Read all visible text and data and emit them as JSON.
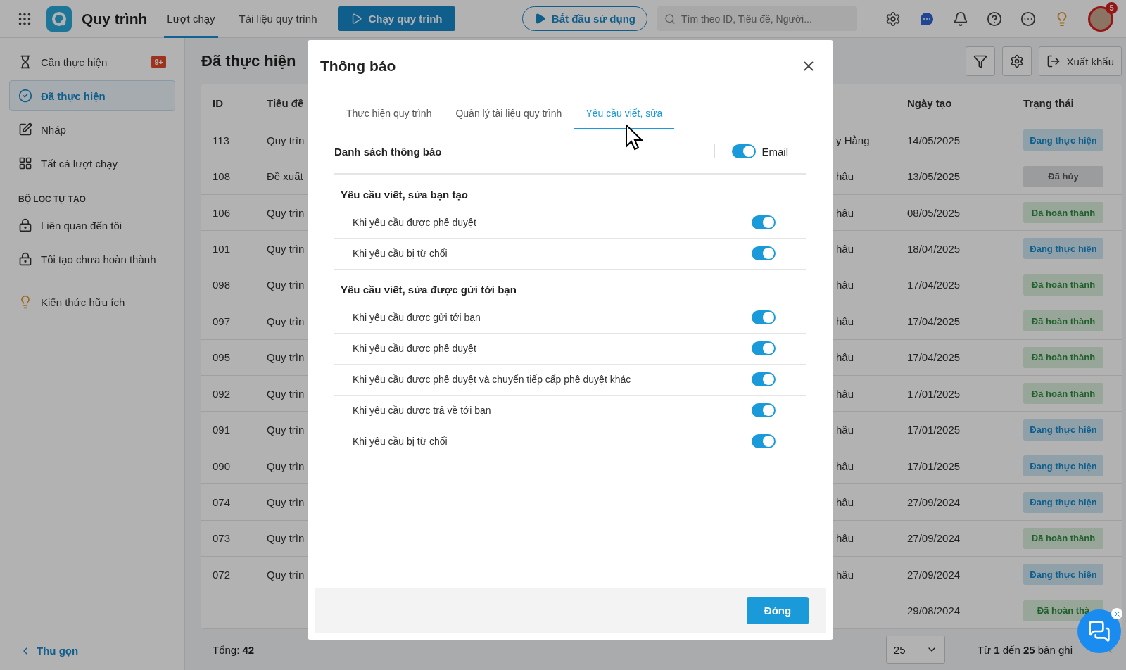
{
  "app": {
    "name": "Quy trình",
    "nav": [
      {
        "label": "Lượt chạy",
        "selected": true
      },
      {
        "label": "Tài liệu quy trình",
        "selected": false
      }
    ],
    "run_button": "Chạy quy trình",
    "start_button": "Bắt đầu sử dụng",
    "search": {
      "placeholder": "Tìm theo ID, Tiêu đề, Người..."
    },
    "notification_count": "5"
  },
  "sidebar": {
    "items": [
      {
        "label": "Cần thực hiện",
        "selected": false,
        "badge": "9+"
      },
      {
        "label": "Đã thực hiện",
        "selected": true
      },
      {
        "label": "Nháp",
        "selected": false
      },
      {
        "label": "Tất cả lượt chạy",
        "selected": false
      }
    ],
    "filter_heading": "BỘ LỌC TỰ TẠO",
    "filters": [
      {
        "label": "Liên quan đến tôi",
        "selected": false
      },
      {
        "label": "Tôi tạo chưa hoàn thành",
        "selected": false
      }
    ],
    "knowledge": "Kiến thức hữu ích",
    "collapse": "Thu gọn"
  },
  "page": {
    "title": "Đã thực hiện",
    "export_button": "Xuất khẩu",
    "table": {
      "columns": [
        "ID",
        "Tiêu đề",
        "Ngày tạo",
        "Trạng thái"
      ],
      "rows": [
        {
          "id": "113",
          "title": "Quy trìn",
          "column_3": "y Hằng",
          "date": "14/05/2025",
          "status": {
            "text": "Đang thực hiện",
            "kind": "progress"
          }
        },
        {
          "id": "108",
          "title": "Đề xuất",
          "column_3": "hâu",
          "date": "13/05/2025",
          "status": {
            "text": "Đã hủy",
            "kind": "cancelled"
          }
        },
        {
          "id": "106",
          "title": "Quy trìn",
          "column_3": "hâu",
          "date": "08/05/2025",
          "status": {
            "text": "Đã hoàn thành",
            "kind": "done"
          }
        },
        {
          "id": "101",
          "title": "Quy trìn",
          "column_3": "hâu",
          "date": "18/04/2025",
          "status": {
            "text": "Đang thực hiện",
            "kind": "progress"
          }
        },
        {
          "id": "098",
          "title": "Quy trìn",
          "column_3": "hâu",
          "date": "17/04/2025",
          "status": {
            "text": "Đã hoàn thành",
            "kind": "done"
          }
        },
        {
          "id": "097",
          "title": "Quy trìn",
          "column_3": "hâu",
          "date": "17/04/2025",
          "status": {
            "text": "Đã hoàn thành",
            "kind": "done"
          }
        },
        {
          "id": "095",
          "title": "Quy trìn",
          "column_3": "hâu",
          "date": "17/04/2025",
          "status": {
            "text": "Đã hoàn thành",
            "kind": "done"
          }
        },
        {
          "id": "092",
          "title": "Quy trìn",
          "column_3": "hâu",
          "date": "17/01/2025",
          "status": {
            "text": "Đã hoàn thành",
            "kind": "done"
          }
        },
        {
          "id": "091",
          "title": "Quy trìn",
          "column_3": "hâu",
          "date": "17/01/2025",
          "status": {
            "text": "Đang thực hiện",
            "kind": "progress"
          }
        },
        {
          "id": "090",
          "title": "Quy trìn",
          "column_3": "hâu",
          "date": "17/01/2025",
          "status": {
            "text": "Đang thực hiện",
            "kind": "progress"
          }
        },
        {
          "id": "074",
          "title": "Quy trìn",
          "column_3": "hâu",
          "date": "27/09/2024",
          "status": {
            "text": "Đang thực hiện",
            "kind": "progress"
          }
        },
        {
          "id": "073",
          "title": "Quy trìn",
          "column_3": "hâu",
          "date": "27/09/2024",
          "status": {
            "text": "Đã hoàn thành",
            "kind": "done"
          }
        },
        {
          "id": "072",
          "title": "Quy trìn",
          "column_3": "hâu",
          "date": "27/09/2024",
          "status": {
            "text": "Đang thực hiện",
            "kind": "progress"
          }
        },
        {
          "date": "29/08/2024",
          "status": {
            "text": "Đã hoàn thà",
            "kind": "done"
          }
        }
      ]
    },
    "total": "Tổng: **42**",
    "page_size": "25",
    "range": "Từ **1** đến **25** bản ghi"
  },
  "dialog": {
    "title": "Thông báo",
    "tabs": [
      {
        "label": "Thực hiện quy trình",
        "selected": false
      },
      {
        "label": "Quản lý tài liệu quy trình",
        "selected": false
      },
      {
        "label": "Yêu cầu viết, sửa",
        "selected": true
      }
    ],
    "list_heading": "Danh sách thông báo",
    "email": {
      "label": "Email",
      "on": true
    },
    "sections": [
      {
        "title": "Yêu cầu viết, sửa bạn tạo",
        "items": [
          {
            "label": "Khi yêu cầu được phê duyệt",
            "on": true
          },
          {
            "label": "Khi yêu cầu bị từ chối",
            "on": true
          }
        ]
      },
      {
        "title": "Yêu cầu viết, sửa được gửi tới bạn",
        "items": [
          {
            "label": "Khi yêu cầu được gửi tới bạn",
            "on": true
          },
          {
            "label": "Khi yêu cầu được phê duyệt",
            "on": true
          },
          {
            "label": "Khi yêu cầu được phê duyệt và chuyển tiếp cấp phê duyệt khác",
            "on": true
          },
          {
            "label": "Khi yêu cầu được trả về tới bạn",
            "on": true
          },
          {
            "label": "Khi yêu cầu bị từ chối",
            "on": true
          }
        ]
      }
    ],
    "close_button": "Đóng"
  }
}
